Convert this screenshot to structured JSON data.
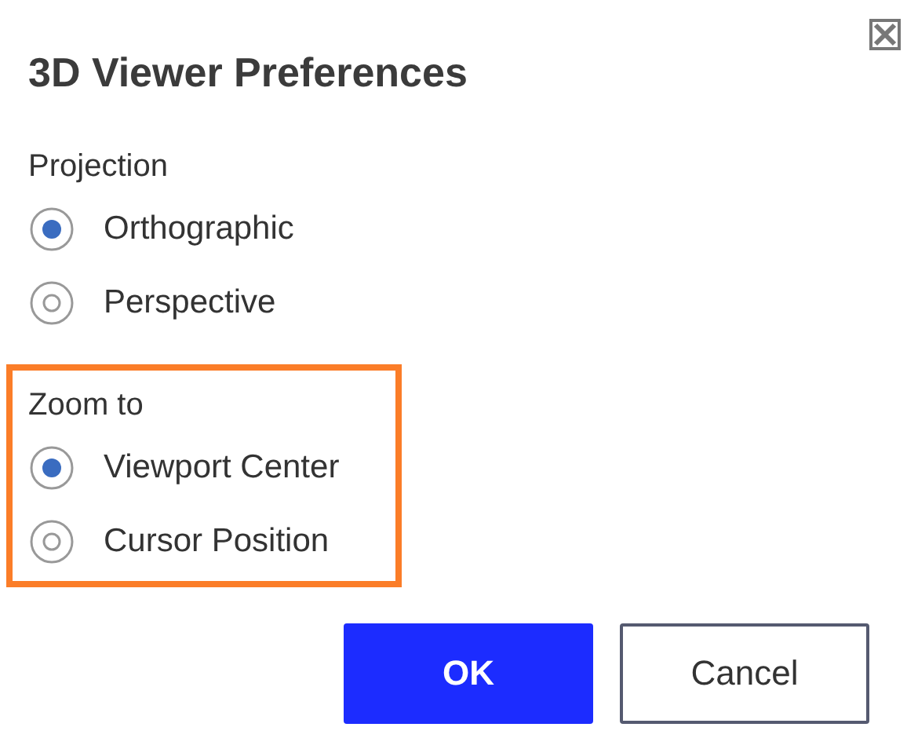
{
  "dialog": {
    "title": "3D Viewer Preferences"
  },
  "groups": [
    {
      "label": "Projection",
      "highlighted": false,
      "options": [
        {
          "label": "Orthographic",
          "selected": true
        },
        {
          "label": "Perspective",
          "selected": false
        }
      ]
    },
    {
      "label": "Zoom to",
      "highlighted": true,
      "options": [
        {
          "label": "Viewport Center",
          "selected": true
        },
        {
          "label": "Cursor Position",
          "selected": false
        }
      ]
    }
  ],
  "buttons": [
    {
      "label": "OK",
      "kind": "primary"
    },
    {
      "label": "Cancel",
      "kind": "secondary"
    }
  ]
}
